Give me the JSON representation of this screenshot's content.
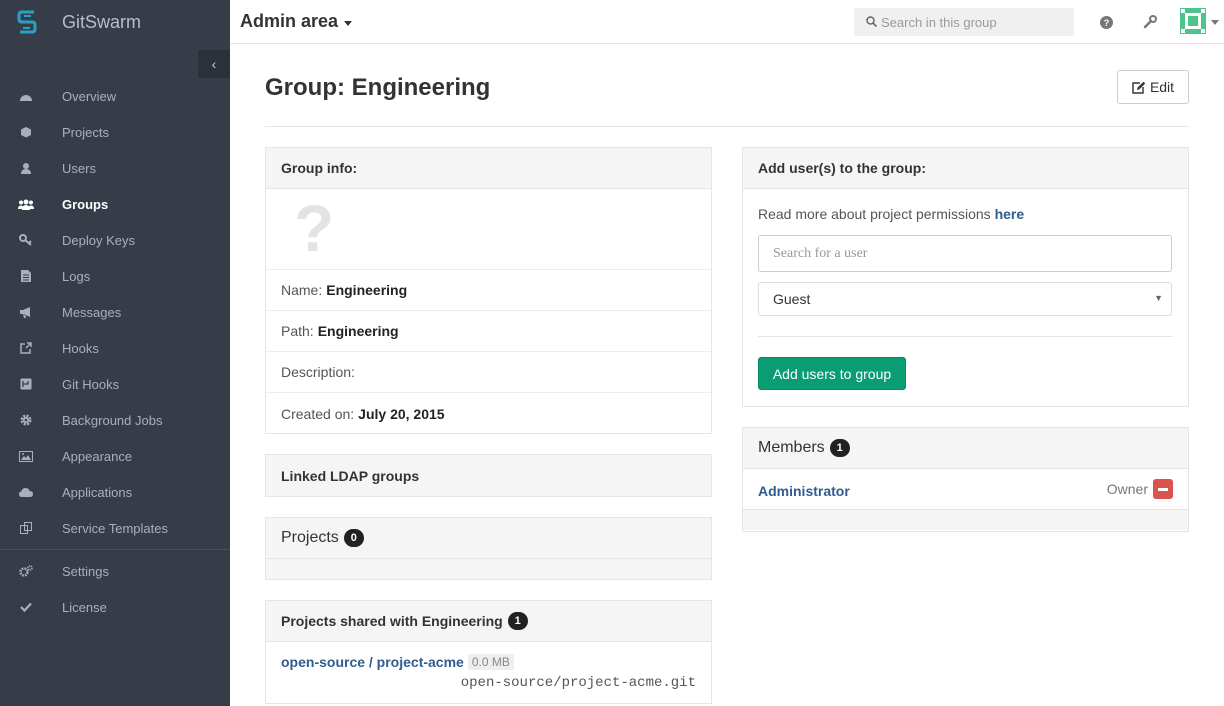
{
  "brand": {
    "name": "GitSwarm",
    "accent": "#26a3c4"
  },
  "sidebar": {
    "items": [
      {
        "label": "Overview",
        "icon": "dashboard-icon"
      },
      {
        "label": "Projects",
        "icon": "cube-icon"
      },
      {
        "label": "Users",
        "icon": "user-icon"
      },
      {
        "label": "Groups",
        "icon": "users-icon",
        "active": true
      },
      {
        "label": "Deploy Keys",
        "icon": "key-icon"
      },
      {
        "label": "Logs",
        "icon": "file-icon"
      },
      {
        "label": "Messages",
        "icon": "bullhorn-icon"
      },
      {
        "label": "Hooks",
        "icon": "external-link-icon"
      },
      {
        "label": "Git Hooks",
        "icon": "git-hook-icon"
      },
      {
        "label": "Background Jobs",
        "icon": "cog-icon"
      },
      {
        "label": "Appearance",
        "icon": "image-icon"
      },
      {
        "label": "Applications",
        "icon": "cloud-icon"
      },
      {
        "label": "Service Templates",
        "icon": "copy-icon"
      }
    ],
    "bottom_items": [
      {
        "label": "Settings",
        "icon": "cogs-icon"
      },
      {
        "label": "License",
        "icon": "check-icon"
      }
    ]
  },
  "header": {
    "title": "Admin area",
    "search_placeholder": "Search in this group"
  },
  "page": {
    "title": "Group: Engineering",
    "edit_label": "Edit"
  },
  "group_info": {
    "heading": "Group info:",
    "avatar_placeholder": "?",
    "name_label": "Name:",
    "name_value": "Engineering",
    "path_label": "Path:",
    "path_value": "Engineering",
    "description_label": "Description:",
    "created_label": "Created on:",
    "created_value": "July 20, 2015"
  },
  "ldap": {
    "heading": "Linked LDAP groups"
  },
  "projects": {
    "heading": "Projects",
    "count": "0"
  },
  "shared": {
    "heading": "Projects shared with Engineering",
    "count": "1",
    "project_link": "open-source / project-acme",
    "project_size": "0.0 MB",
    "project_git": "open-source/project-acme.git"
  },
  "add_users": {
    "heading": "Add user(s) to the group:",
    "permissions_text": "Read more about project permissions",
    "permissions_link": "here",
    "search_placeholder": "Search for a user",
    "role_selected": "Guest",
    "submit_label": "Add users to group"
  },
  "members": {
    "heading": "Members",
    "count": "1",
    "items": [
      {
        "name": "Administrator",
        "role": "Owner"
      }
    ]
  }
}
